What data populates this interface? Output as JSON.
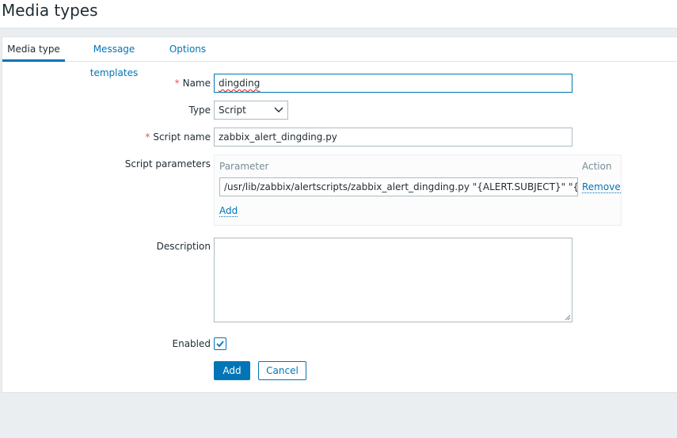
{
  "page": {
    "title": "Media types"
  },
  "tabs": [
    {
      "label": "Media type",
      "active": true
    },
    {
      "label": "Message templates",
      "active": false
    },
    {
      "label": "Options",
      "active": false
    }
  ],
  "form": {
    "name": {
      "label": "Name",
      "required": true,
      "value": "dingding"
    },
    "type": {
      "label": "Type",
      "value": "Script"
    },
    "script_name": {
      "label": "Script name",
      "required": true,
      "value": "zabbix_alert_dingding.py"
    },
    "script_parameters": {
      "label": "Script parameters",
      "col_parameter": "Parameter",
      "col_action": "Action",
      "rows": [
        {
          "value": "/usr/lib/zabbix/alertscripts/zabbix_alert_dingding.py  \"{ALERT.SUBJECT}\" \"{ALERT.",
          "action": "Remove"
        }
      ],
      "add_label": "Add"
    },
    "description": {
      "label": "Description",
      "value": ""
    },
    "enabled": {
      "label": "Enabled",
      "checked": true
    },
    "buttons": {
      "add": "Add",
      "cancel": "Cancel"
    }
  },
  "colors": {
    "accent": "#0275b8",
    "required": "#e45959",
    "border": "#acbbc2",
    "background": "#ebeef0"
  },
  "icons": {
    "type_dropdown": "chevron-down-icon",
    "enabled_check": "checkmark-icon",
    "textarea_resize": "resize-grip-icon"
  }
}
